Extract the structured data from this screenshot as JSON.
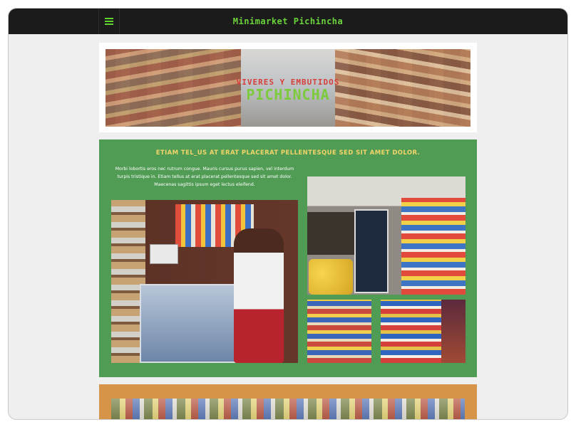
{
  "header": {
    "title": "Minimarket Pichincha",
    "menu_icon": "hamburger-menu-icon",
    "title_color": "#6bd33a",
    "bar_color": "#1b1b1b"
  },
  "banner": {
    "subtitle": "VIVERES Y EMBUTIDOS",
    "title": "PICHINCHA"
  },
  "green_section": {
    "heading": "ETIAM TEL_US AT ERAT PLACERAT PELLENTESQUE SED SIT AMET DOLOR.",
    "paragraph": "Morbi lobortis eros nec rutrum congue. Mauris cursus purus sapien, vel interdum turpis tristique in. Etiam tellus at erat placerat pellentesque sed sit amet dolor. Maecenas sagittis ipsum eget lectus eleifend.",
    "background": "#519c55",
    "heading_color": "#f1d468"
  },
  "orange_section": {
    "background": "#d69448"
  }
}
